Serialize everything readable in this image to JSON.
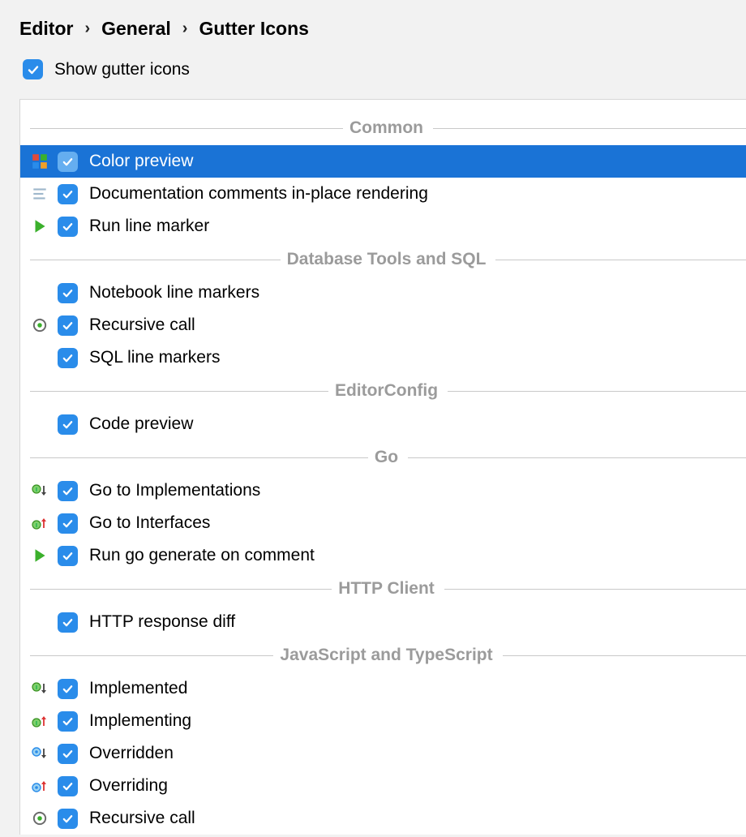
{
  "breadcrumb": [
    "Editor",
    "General",
    "Gutter Icons"
  ],
  "top_checkbox": {
    "checked": true,
    "label": "Show gutter icons"
  },
  "groups": [
    {
      "title": "Common",
      "items": [
        {
          "icon": "color-square",
          "checked": true,
          "label": "Color preview",
          "selected": true
        },
        {
          "icon": "doc-lines",
          "checked": true,
          "label": "Documentation comments in-place rendering"
        },
        {
          "icon": "run-play",
          "checked": true,
          "label": "Run line marker"
        }
      ]
    },
    {
      "title": "Database Tools and SQL",
      "items": [
        {
          "icon": "none",
          "checked": true,
          "label": "Notebook line markers"
        },
        {
          "icon": "recursive",
          "checked": true,
          "label": "Recursive call"
        },
        {
          "icon": "none",
          "checked": true,
          "label": "SQL line markers"
        }
      ]
    },
    {
      "title": "EditorConfig",
      "items": [
        {
          "icon": "none",
          "checked": true,
          "label": "Code preview"
        }
      ]
    },
    {
      "title": "Go",
      "items": [
        {
          "icon": "impl-down",
          "checked": true,
          "label": "Go to Implementations"
        },
        {
          "icon": "impl-up",
          "checked": true,
          "label": "Go to Interfaces"
        },
        {
          "icon": "run-play",
          "checked": true,
          "label": "Run go generate on comment"
        }
      ]
    },
    {
      "title": "HTTP Client",
      "items": [
        {
          "icon": "none",
          "checked": true,
          "label": "HTTP response diff"
        }
      ]
    },
    {
      "title": "JavaScript and TypeScript",
      "items": [
        {
          "icon": "impl-down",
          "checked": true,
          "label": "Implemented"
        },
        {
          "icon": "impl-up",
          "checked": true,
          "label": "Implementing"
        },
        {
          "icon": "over-down",
          "checked": true,
          "label": "Overridden"
        },
        {
          "icon": "over-up",
          "checked": true,
          "label": "Overriding"
        },
        {
          "icon": "recursive",
          "checked": true,
          "label": "Recursive call"
        }
      ]
    }
  ]
}
